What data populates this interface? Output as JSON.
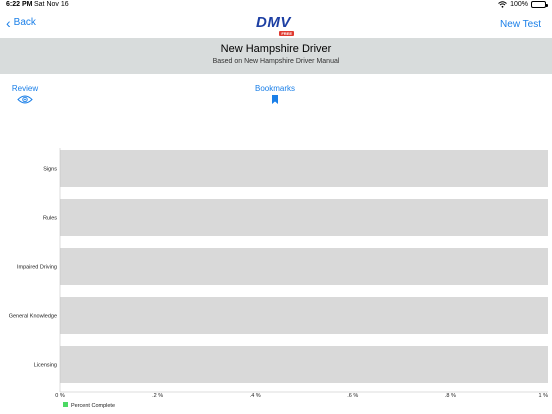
{
  "status_bar": {
    "time": "6:22 PM",
    "date": "Sat Nov 16",
    "battery": "100%"
  },
  "nav": {
    "back_label": "Back",
    "logo_text": "DMV",
    "logo_badge": "FREE",
    "new_test_label": "New Test"
  },
  "header": {
    "title": "New Hampshire Driver",
    "subtitle": "Based on New Hampshire Driver Manual"
  },
  "tabs": [
    {
      "label": "Review",
      "icon": "eye-icon"
    },
    {
      "label": "Bookmarks",
      "icon": "bookmark-icon"
    }
  ],
  "colors": {
    "accent": "#1a7fe8",
    "bar": "#d9d9d9",
    "legend": "#4cd964",
    "header_band": "#d8dcdc"
  },
  "chart_data": {
    "type": "bar",
    "orientation": "horizontal",
    "categories": [
      "Signs",
      "Rules",
      "Impaired Driving",
      "General Knowledge",
      "Licensing"
    ],
    "series": [
      {
        "name": "Percent Complete",
        "values": [
          1,
          1,
          1,
          1,
          1
        ]
      }
    ],
    "xlim": [
      0,
      1
    ],
    "x_ticks": [
      0,
      0.2,
      0.4,
      0.6,
      0.8,
      1
    ],
    "x_tick_labels": [
      "0 %",
      ".2 %",
      ".4 %",
      ".6 %",
      ".8 %",
      "1 %"
    ],
    "legend_position": "bottom-left",
    "grid": false
  }
}
